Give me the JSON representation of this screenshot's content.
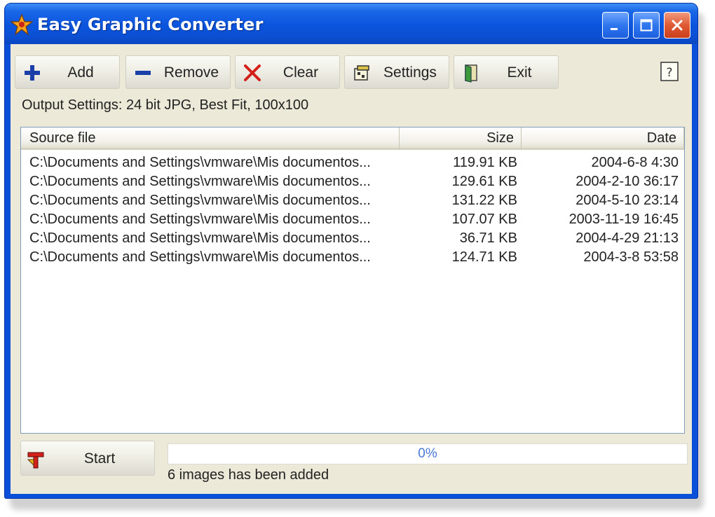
{
  "window": {
    "title": "Easy Graphic Converter",
    "controls": {
      "minimize_icon": "minimize-icon",
      "maximize_icon": "maximize-icon",
      "close_icon": "close-icon"
    }
  },
  "toolbar": {
    "buttons": [
      {
        "label": "Add",
        "icon": "plus-icon"
      },
      {
        "label": "Remove",
        "icon": "minus-icon"
      },
      {
        "label": "Clear",
        "icon": "x-icon"
      },
      {
        "label": "Settings",
        "icon": "settings-icon"
      },
      {
        "label": "Exit",
        "icon": "door-icon"
      }
    ],
    "help_icon": "help-icon"
  },
  "output_settings": "Output Settings: 24 bit JPG, Best Fit, 100x100",
  "file_list": {
    "columns": [
      "Source file",
      "Size",
      "Date"
    ],
    "rows": [
      {
        "source": "C:\\Documents and Settings\\vmware\\Mis documentos...",
        "size": "119.91 KB",
        "date": "2004-6-8 4:30"
      },
      {
        "source": "C:\\Documents and Settings\\vmware\\Mis documentos...",
        "size": "129.61 KB",
        "date": "2004-2-10 36:17"
      },
      {
        "source": "C:\\Documents and Settings\\vmware\\Mis documentos...",
        "size": "131.22 KB",
        "date": "2004-5-10 23:14"
      },
      {
        "source": "C:\\Documents and Settings\\vmware\\Mis documentos...",
        "size": "107.07 KB",
        "date": "2003-11-19 16:45"
      },
      {
        "source": "C:\\Documents and Settings\\vmware\\Mis documentos...",
        "size": "36.71 KB",
        "date": "2004-4-29 21:13"
      },
      {
        "source": "C:\\Documents and Settings\\vmware\\Mis documentos...",
        "size": "124.71 KB",
        "date": "2004-3-8 53:58"
      }
    ]
  },
  "start_button": {
    "label": "Start",
    "icon": "start-icon"
  },
  "progress": {
    "value": 0,
    "label": "0%"
  },
  "status": "6 images has been added",
  "colors": {
    "titlebar": "#0a54dc",
    "client": "#ece9d8",
    "accent": "#3d6fd8",
    "close_button": "#e05a34"
  }
}
